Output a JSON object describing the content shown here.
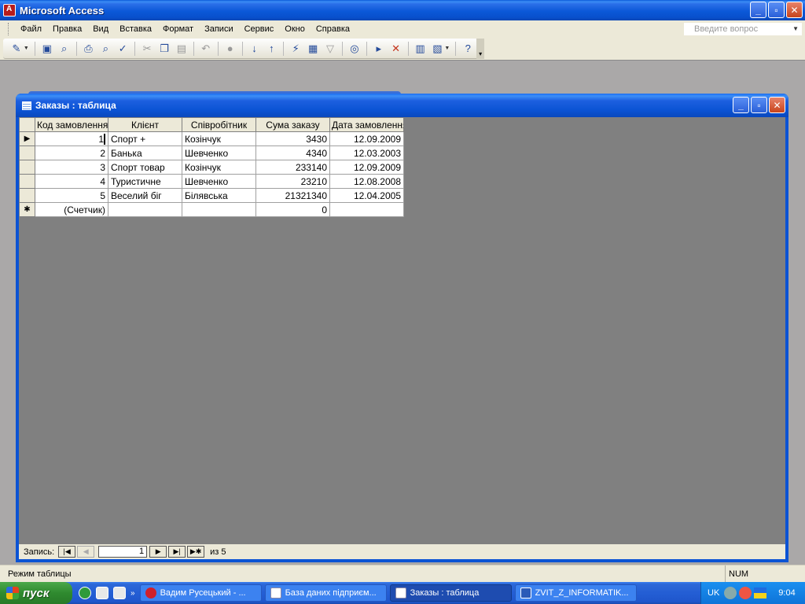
{
  "app": {
    "title": "Microsoft Access",
    "window_buttons": {
      "minimize": "_",
      "maximize": "▫",
      "close": "✕"
    }
  },
  "menu": {
    "items": [
      {
        "label": "Файл"
      },
      {
        "label": "Правка"
      },
      {
        "label": "Вид"
      },
      {
        "label": "Вставка"
      },
      {
        "label": "Формат"
      },
      {
        "label": "Записи"
      },
      {
        "label": "Сервис"
      },
      {
        "label": "Окно"
      },
      {
        "label": "Справка"
      }
    ],
    "ask_placeholder": "Введите вопрос"
  },
  "toolbar": {
    "icons": [
      "view-icon",
      "save-icon",
      "search-file-icon",
      "print-icon",
      "print-preview-icon",
      "spelling-icon",
      "cut-icon",
      "copy-icon",
      "paste-icon",
      "undo-icon",
      "hyperlink-icon",
      "sort-ascending-icon",
      "sort-descending-icon",
      "filter-by-selection-icon",
      "filter-by-form-icon",
      "apply-filter-icon",
      "find-icon",
      "new-record-icon",
      "delete-record-icon",
      "database-window-icon",
      "new-object-icon",
      "help-icon"
    ]
  },
  "child_window": {
    "title": "Заказы : таблица",
    "window_buttons": {
      "minimize": "_",
      "maximize": "▫",
      "close": "✕"
    }
  },
  "datasheet": {
    "columns": [
      "Код замовлення",
      "Клієнт",
      "Співробітник",
      "Сума заказу",
      "Дата замовлення"
    ],
    "rows": [
      {
        "id": "1",
        "client": "Спорт +",
        "employee": "Козінчук",
        "sum": "3430",
        "date": "12.09.2009"
      },
      {
        "id": "2",
        "client": "Банька",
        "employee": "Шевченко",
        "sum": "4340",
        "date": "12.03.2003"
      },
      {
        "id": "3",
        "client": "Спорт товар",
        "employee": "Козінчук",
        "sum": "233140",
        "date": "12.09.2009"
      },
      {
        "id": "4",
        "client": "Туристичне",
        "employee": "Шевченко",
        "sum": "23210",
        "date": "12.08.2008"
      },
      {
        "id": "5",
        "client": "Веселий біг",
        "employee": "Білявська",
        "sum": "21321340",
        "date": "12.04.2005"
      }
    ],
    "new_row": {
      "id": "(Счетчик)",
      "sum": "0"
    },
    "selectors": {
      "current": "▶",
      "new": "✱"
    }
  },
  "record_nav": {
    "label": "Запись:",
    "current": "1",
    "of_text": "из 5",
    "buttons": {
      "first": "|◀",
      "prev": "◀",
      "next": "▶",
      "last": "▶|",
      "new": "▶✱"
    }
  },
  "status": {
    "mode": "Режим таблицы",
    "num": "NUM"
  },
  "taskbar": {
    "start_label": "пуск",
    "quick_more": "»",
    "tasks": [
      {
        "label": "Вадим Русецький - ...",
        "icon": "opera-icon",
        "active": false
      },
      {
        "label": "База даних підприєм...",
        "icon": "database-icon",
        "active": false
      },
      {
        "label": "Заказы : таблица",
        "icon": "table-icon",
        "active": true
      },
      {
        "label": "ZVIT_Z_INFORMATIK...",
        "icon": "word-icon",
        "active": false
      }
    ],
    "tray": {
      "lang": "UK",
      "time": "9:04"
    }
  }
}
